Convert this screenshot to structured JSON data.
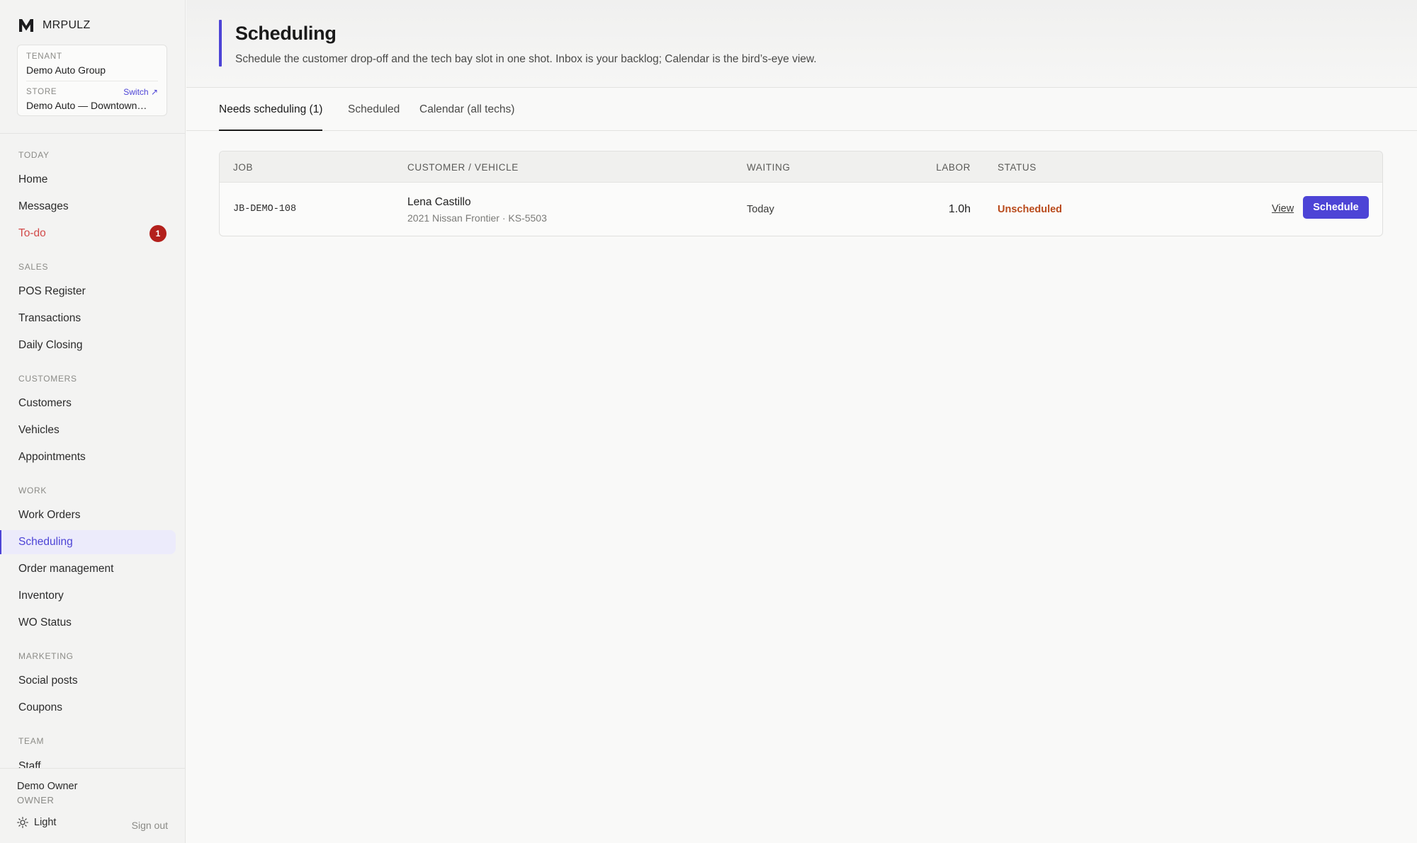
{
  "app": {
    "brand": "MRPULZ",
    "logo_icon": "m-logo-icon"
  },
  "context": {
    "tenant_label": "TENANT",
    "tenant_value": "Demo Auto Group",
    "store_label": "STORE",
    "store_value": "Demo Auto — Downtown…",
    "switch_label": "Switch ↗"
  },
  "nav": {
    "sections": {
      "today": "TODAY",
      "sales": "SALES",
      "customers": "CUSTOMERS",
      "work": "WORK",
      "marketing": "MARKETING",
      "team": "TEAM"
    },
    "items": {
      "home": "Home",
      "messages": "Messages",
      "todo": "To-do",
      "todo_badge": "1",
      "pos_register": "POS Register",
      "transactions": "Transactions",
      "daily_closing": "Daily Closing",
      "customers": "Customers",
      "vehicles": "Vehicles",
      "appointments": "Appointments",
      "work_orders": "Work Orders",
      "scheduling": "Scheduling",
      "order_management": "Order management",
      "inventory": "Inventory",
      "wo_status": "WO Status",
      "social_posts": "Social posts",
      "coupons": "Coupons",
      "staff": "Staff"
    },
    "active": "scheduling"
  },
  "footer": {
    "user_name": "Demo Owner",
    "user_role": "OWNER",
    "theme_label": "Light",
    "sign_out": "Sign out"
  },
  "page": {
    "title": "Scheduling",
    "subtitle": "Schedule the customer drop-off and the tech bay slot in one shot. Inbox is your backlog; Calendar is the bird’s-eye view."
  },
  "tabs": [
    {
      "label": "Needs scheduling (1)",
      "active": true
    },
    {
      "label": "Scheduled",
      "active": false
    },
    {
      "label": "Calendar (all techs)",
      "active": false
    }
  ],
  "table": {
    "columns": {
      "job": "JOB",
      "customer_vehicle": "CUSTOMER / VEHICLE",
      "waiting": "WAITING",
      "labor": "LABOR",
      "status": "STATUS"
    },
    "rows": [
      {
        "job": "JB-DEMO-108",
        "customer": "Lena Castillo",
        "vehicle": "2021 Nissan Frontier · KS-5503",
        "waiting": "Today",
        "labor": "1.0h",
        "status": "Unscheduled",
        "view_label": "View",
        "schedule_label": "Schedule"
      }
    ]
  },
  "colors": {
    "accent": "#4d44d6",
    "alert": "#b3201c",
    "status_unscheduled": "#b94a1b"
  }
}
